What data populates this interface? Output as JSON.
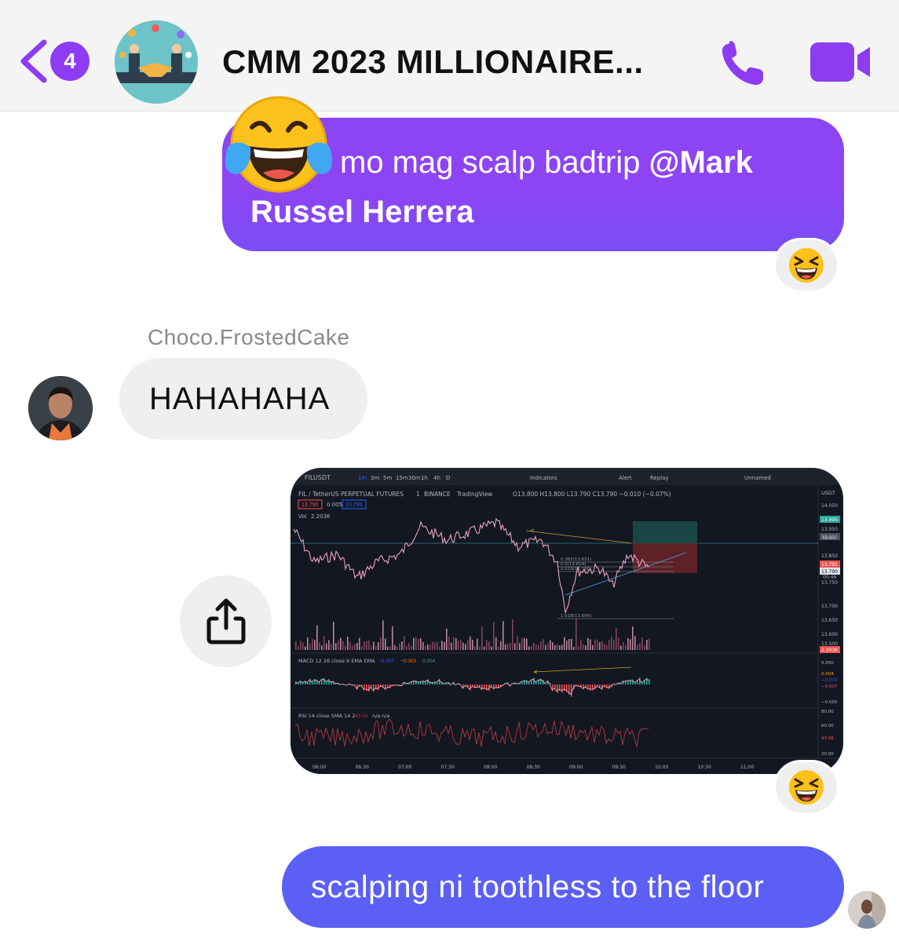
{
  "header": {
    "unread_count": "4",
    "title": "CMM 2023 MILLIONAIRE...",
    "icons": {
      "back": "chevron-left-icon",
      "call": "phone-icon",
      "video": "video-camera-icon"
    },
    "accent_color": "#8d3cf2"
  },
  "messages": [
    {
      "id": "out-1",
      "direction": "outgoing",
      "emoji": "face-with-tears-of-joy",
      "text_lead": "mo mag scalp badtrip",
      "mention": "@Mark Russel Herrera",
      "mention_line1": "@Mark",
      "mention_line2": "Russel Herrera",
      "reaction": "😆"
    },
    {
      "id": "in-1",
      "direction": "incoming",
      "sender": "Choco.FrostedCake",
      "text": "HAHAHAHA"
    },
    {
      "id": "out-2",
      "direction": "outgoing",
      "type": "image",
      "reaction": "😆"
    },
    {
      "id": "out-3",
      "direction": "outgoing",
      "text": "scalping ni toothless to the floor"
    }
  ],
  "screenshot": {
    "symbol": "FILUSDT",
    "timeframes": [
      "1m",
      "3m",
      "5m",
      "15m",
      "30m",
      "1h",
      "4h",
      "D"
    ],
    "toolbar": {
      "indicators": "Indicators",
      "alert": "Alert",
      "replay": "Replay",
      "layout": "Unnamed"
    },
    "instrument": "FIL / TetherUS PERPETUAL FUTURES",
    "interval": "1",
    "exchange": "BINANCE",
    "source": "TradingView",
    "ohlc": "O13.800 H13.800 L13.790 C13.790 −0.010 (−0.07%)",
    "sell_price": "13.790",
    "spread": "0.005",
    "buy_price": "13.795",
    "vol_label": "Vol",
    "vol_value": "2.203K",
    "currency": "USDT",
    "price_axis": [
      "14.050",
      "13.995",
      "13.950",
      "13.902",
      "13.850",
      "13.791",
      "13.790",
      "13.750",
      "13.700",
      "13.650",
      "13.600",
      "13.550",
      "13.500",
      "2.203K"
    ],
    "news_label": "News",
    "countdown": "00:46",
    "fib_labels": [
      "0.382(13.831)",
      "0.5(13.814)",
      "0.618(13.798)",
      "1.618(13.606)"
    ],
    "macd_label": "MACD 12 26 close 9 EMA EMA",
    "macd_values": [
      "−0.007",
      "−0.003",
      "0.004"
    ],
    "macd_axis": [
      "0.050",
      "0.004",
      "−0.003",
      "−0.007",
      "−0.050"
    ],
    "rsi_label": "RSI 14 close SMA 14 2",
    "rsi_values": [
      "43.08",
      "n/a",
      "n/a"
    ],
    "rsi_axis": [
      "80.00",
      "60.00",
      "43.08",
      "20.00"
    ],
    "time_axis": [
      "06:00",
      "06:30",
      "07:00",
      "07:30",
      "08:00",
      "08:30",
      "09:00",
      "09:30",
      "10:00",
      "10:30",
      "11:00"
    ],
    "colors": {
      "up": "#26a69a",
      "down": "#ef5350",
      "candle": "#e6a3b8",
      "bg": "#131722"
    }
  }
}
